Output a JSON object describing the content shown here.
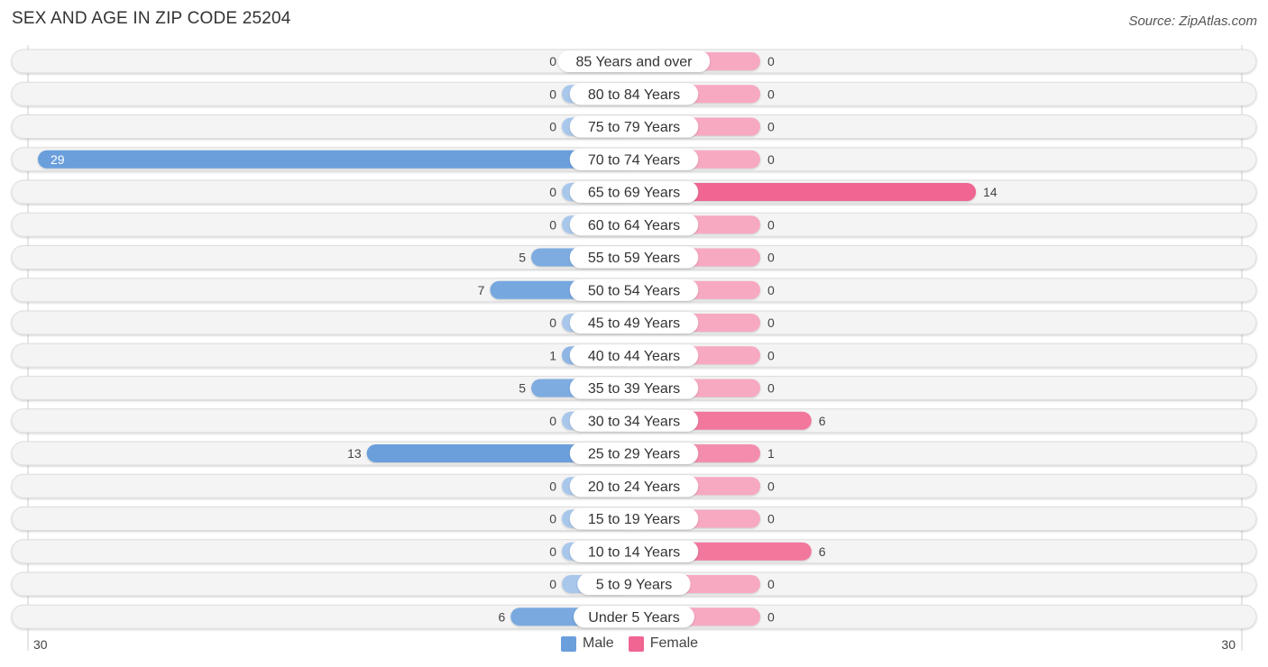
{
  "header": {
    "title": "SEX AND AGE IN ZIP CODE 25204",
    "source": "Source: ZipAtlas.com"
  },
  "colors": {
    "male_strong": "#6a9fdc",
    "male_light": "#a9c7eb",
    "female_strong": "#f06591",
    "female_light": "#f7a9c1",
    "row_bg": "#f4f4f4",
    "row_border": "#dddddd"
  },
  "chart_data": {
    "type": "bar",
    "orientation": "horizontal-diverging",
    "title": "SEX AND AGE IN ZIP CODE 25204",
    "categories": [
      "85 Years and over",
      "80 to 84 Years",
      "75 to 79 Years",
      "70 to 74 Years",
      "65 to 69 Years",
      "60 to 64 Years",
      "55 to 59 Years",
      "50 to 54 Years",
      "45 to 49 Years",
      "40 to 44 Years",
      "35 to 39 Years",
      "30 to 34 Years",
      "25 to 29 Years",
      "20 to 24 Years",
      "15 to 19 Years",
      "10 to 14 Years",
      "5 to 9 Years",
      "Under 5 Years"
    ],
    "series": [
      {
        "name": "Male",
        "values": [
          0,
          0,
          0,
          29,
          0,
          0,
          5,
          7,
          0,
          1,
          5,
          0,
          13,
          0,
          0,
          0,
          0,
          6
        ]
      },
      {
        "name": "Female",
        "values": [
          0,
          0,
          0,
          0,
          14,
          0,
          0,
          0,
          0,
          0,
          0,
          6,
          1,
          0,
          0,
          6,
          0,
          0
        ]
      }
    ],
    "xlim": [
      -30,
      30
    ],
    "axis_tick_labels": {
      "left": "30",
      "right": "30"
    },
    "legend": {
      "position": "bottom-center",
      "entries": [
        "Male",
        "Female"
      ]
    },
    "grid": false
  }
}
